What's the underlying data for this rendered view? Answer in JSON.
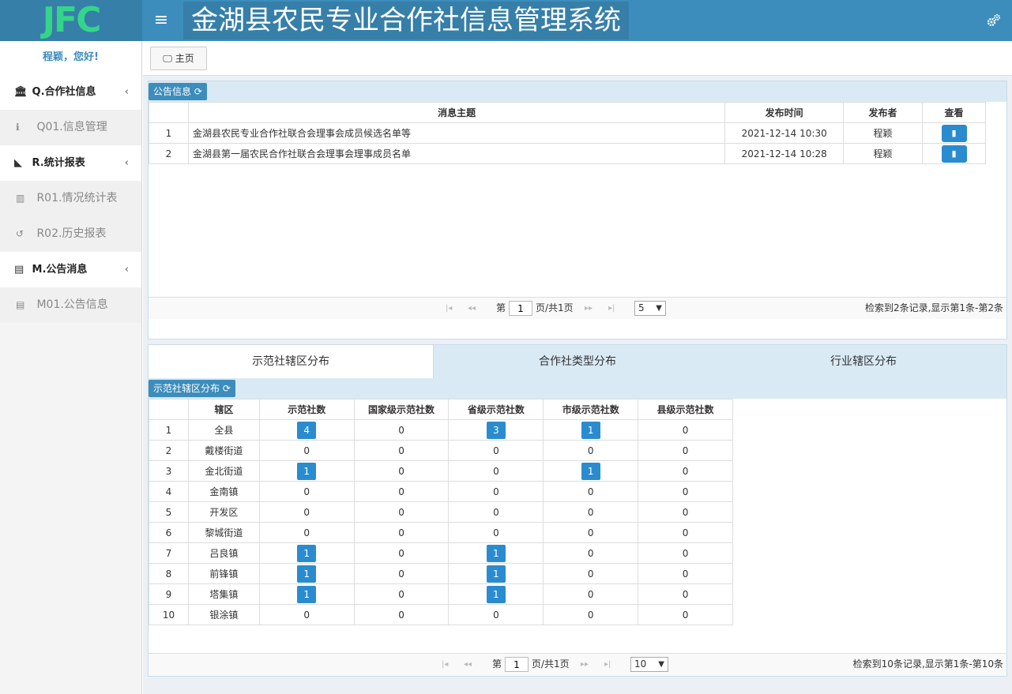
{
  "header": {
    "logo": "JFC",
    "title": "金湖县农民专业合作社信息管理系统"
  },
  "sidebar": {
    "greeting": "程颖，您好!",
    "groups": [
      {
        "label": "Q.合作社信息",
        "icon": "bank-icon",
        "items": [
          {
            "label": "Q01.信息管理",
            "icon": "info-icon"
          }
        ]
      },
      {
        "label": "R.统计报表",
        "icon": "area-chart-icon",
        "items": [
          {
            "label": "R01.情况统计表",
            "icon": "bar-chart-icon"
          },
          {
            "label": "R02.历史报表",
            "icon": "history-icon"
          }
        ]
      },
      {
        "label": "M.公告消息",
        "icon": "newspaper-icon",
        "items": [
          {
            "label": "M01.公告信息",
            "icon": "newspaper-icon"
          }
        ]
      }
    ]
  },
  "topbar": {
    "home_label": "主页"
  },
  "announcements": {
    "tag": "公告信息",
    "columns": [
      "消息主题",
      "发布时间",
      "发布者",
      "查看"
    ],
    "rows": [
      {
        "n": "1",
        "title": "金湖县农民专业合作社联合会理事会成员候选名单等",
        "time": "2021-12-14 10:30",
        "publisher": "程颖"
      },
      {
        "n": "2",
        "title": "金湖县第一届农民合作社联合会理事会理事成员名单",
        "time": "2021-12-14 10:28",
        "publisher": "程颖"
      }
    ],
    "pager": {
      "page_prefix": "第",
      "page": "1",
      "page_suffix": "页/共1页",
      "page_size": "5",
      "summary": "检索到2条记录,显示第1条-第2条"
    }
  },
  "tabs": [
    "示范社辖区分布",
    "合作社类型分布",
    "行业辖区分布"
  ],
  "districts": {
    "tag": "示范社辖区分布",
    "columns": [
      "辖区",
      "示范社数",
      "国家级示范社数",
      "省级示范社数",
      "市级示范社数",
      "县级示范社数"
    ],
    "rows": [
      {
        "n": "1",
        "name": "全县",
        "v": [
          4,
          0,
          3,
          1,
          0
        ]
      },
      {
        "n": "2",
        "name": "戴楼街道",
        "v": [
          0,
          0,
          0,
          0,
          0
        ]
      },
      {
        "n": "3",
        "name": "金北街道",
        "v": [
          1,
          0,
          0,
          1,
          0
        ]
      },
      {
        "n": "4",
        "name": "金南镇",
        "v": [
          0,
          0,
          0,
          0,
          0
        ]
      },
      {
        "n": "5",
        "name": "开发区",
        "v": [
          0,
          0,
          0,
          0,
          0
        ]
      },
      {
        "n": "6",
        "name": "黎城街道",
        "v": [
          0,
          0,
          0,
          0,
          0
        ]
      },
      {
        "n": "7",
        "name": "吕良镇",
        "v": [
          1,
          0,
          1,
          0,
          0
        ]
      },
      {
        "n": "8",
        "name": "前锋镇",
        "v": [
          1,
          0,
          1,
          0,
          0
        ]
      },
      {
        "n": "9",
        "name": "塔集镇",
        "v": [
          1,
          0,
          1,
          0,
          0
        ]
      },
      {
        "n": "10",
        "name": "银涂镇",
        "v": [
          0,
          0,
          0,
          0,
          0
        ]
      }
    ],
    "badge_columns": [
      0,
      2,
      3
    ],
    "pager": {
      "page_prefix": "第",
      "page": "1",
      "page_suffix": "页/共1页",
      "page_size": "10",
      "summary": "检索到10条记录,显示第1条-第10条"
    }
  },
  "colors": {
    "header": "#3c8dbc",
    "badge": "#2a8ccf",
    "logo": "#34d58a"
  }
}
